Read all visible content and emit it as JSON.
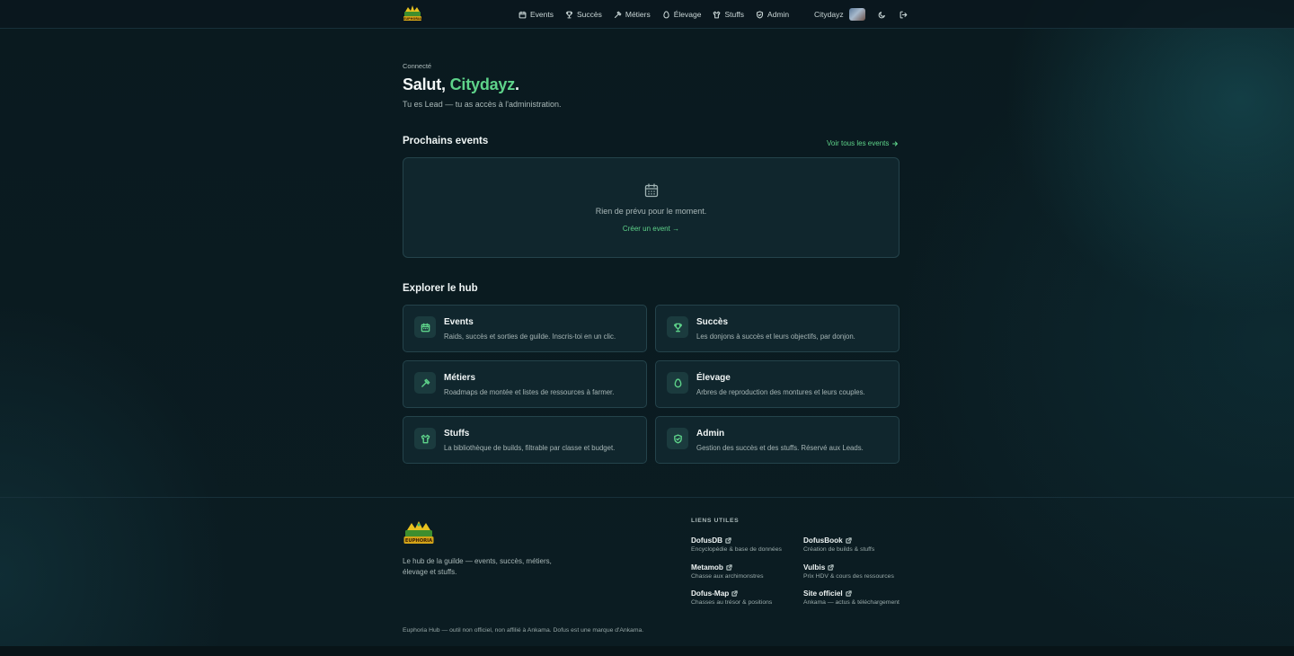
{
  "header": {
    "logo_text": "EUPHORIA",
    "nav": [
      {
        "label": "Events",
        "icon": "calendar-icon"
      },
      {
        "label": "Succès",
        "icon": "trophy-icon"
      },
      {
        "label": "Métiers",
        "icon": "hammer-icon"
      },
      {
        "label": "Élevage",
        "icon": "egg-icon"
      },
      {
        "label": "Stuffs",
        "icon": "shirt-icon"
      },
      {
        "label": "Admin",
        "icon": "shield-icon"
      }
    ],
    "username": "Citydayz"
  },
  "hero": {
    "eyebrow": "Connecté",
    "greeting_prefix": "Salut, ",
    "greeting_name": "Citydayz",
    "greeting_suffix": ".",
    "subtitle": "Tu es Lead — tu as accès à l'administration."
  },
  "events": {
    "title": "Prochains events",
    "see_all": "Voir tous les events",
    "empty_text": "Rien de prévu pour le moment.",
    "create_link": "Créer un event →"
  },
  "hub": {
    "title": "Explorer le hub",
    "cards": [
      {
        "title": "Events",
        "desc": "Raids, succès et sorties de guilde. Inscris-toi en un clic.",
        "icon": "calendar-icon"
      },
      {
        "title": "Succès",
        "desc": "Les donjons à succès et leurs objectifs, par donjon.",
        "icon": "trophy-icon"
      },
      {
        "title": "Métiers",
        "desc": "Roadmaps de montée et listes de ressources à farmer.",
        "icon": "hammer-icon"
      },
      {
        "title": "Élevage",
        "desc": "Arbres de reproduction des montures et leurs couples.",
        "icon": "egg-icon"
      },
      {
        "title": "Stuffs",
        "desc": "La bibliothèque de builds, filtrable par classe et budget.",
        "icon": "shirt-icon"
      },
      {
        "title": "Admin",
        "desc": "Gestion des succès et des stuffs. Réservé aux Leads.",
        "icon": "shield-icon"
      }
    ]
  },
  "footer": {
    "tagline": "Le hub de la guilde — events, succès, métiers, élevage et stuffs.",
    "links_title": "LIENS UTILES",
    "links": [
      {
        "name": "DofusDB",
        "desc": "Encyclopédie & base de données"
      },
      {
        "name": "DofusBook",
        "desc": "Création de builds & stuffs"
      },
      {
        "name": "Metamob",
        "desc": "Chasse aux archimonstres"
      },
      {
        "name": "Vulbis",
        "desc": "Prix HDV & cours des ressources"
      },
      {
        "name": "Dofus-Map",
        "desc": "Chasses au trésor & positions"
      },
      {
        "name": "Site officiel",
        "desc": "Ankama — actus & téléchargement"
      }
    ],
    "disclaimer": "Euphoria Hub — outil non officiel, non affilié à Ankama. Dofus est une marque d'Ankama."
  },
  "colors": {
    "accent": "#5ed38a",
    "background": "#0b1a20",
    "card": "#16303a"
  }
}
